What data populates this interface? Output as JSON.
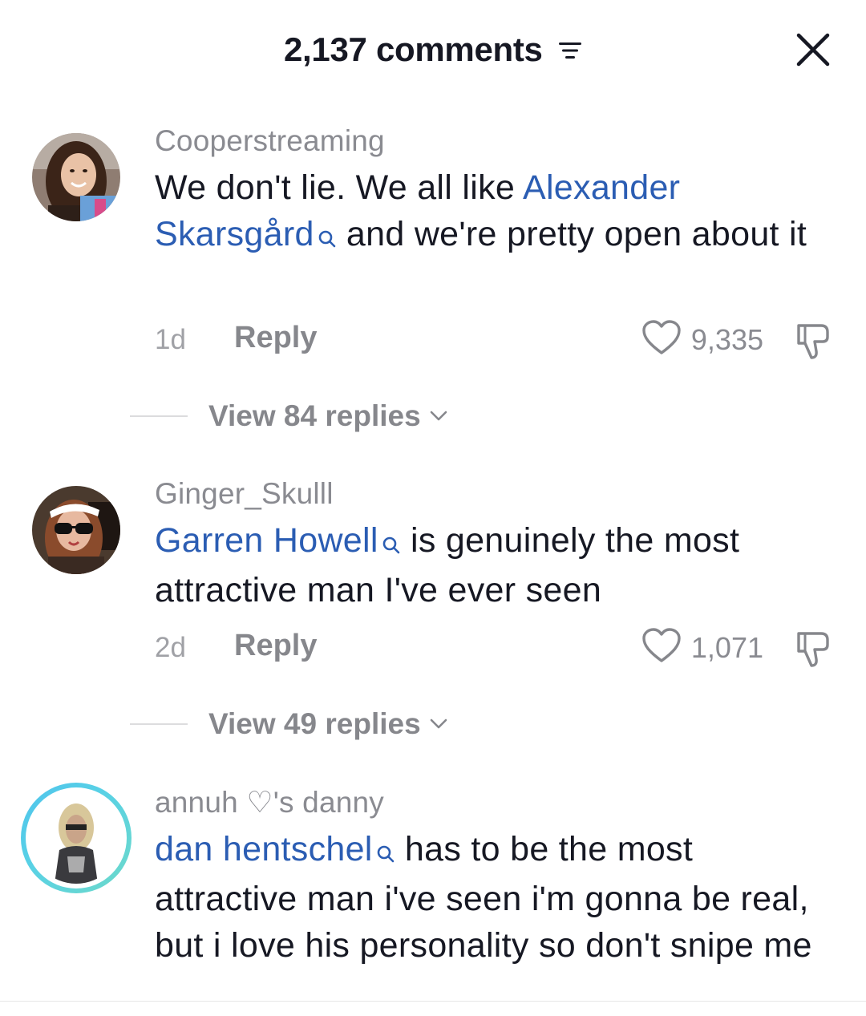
{
  "header": {
    "title": "2,137 comments"
  },
  "comments": [
    {
      "username": "Cooperstreaming",
      "text_before": "We don't lie. We all like ",
      "mention": "Alexander Skarsgård",
      "text_after": " and we're pretty open about it",
      "time": "1d",
      "reply_label": "Reply",
      "likes": "9,335",
      "view_replies": "View 84 replies"
    },
    {
      "username": "Ginger_Skulll",
      "text_before": "",
      "mention": "Garren Howell",
      "text_after": " is genuinely the most attractive man I've ever seen",
      "time": "2d",
      "reply_label": "Reply",
      "likes": "1,071",
      "view_replies": "View 49 replies"
    },
    {
      "username": "annuh ♡'s danny",
      "text_before": "",
      "mention": "dan hentschel",
      "text_after": " has to be the most attractive man i've seen i'm gonna be real, but i love his personality so don't snipe me"
    }
  ],
  "colors": {
    "mention": "#2b5db3",
    "muted": "#8a8b91",
    "text": "#161823",
    "story_ring": "#4fc3ec"
  }
}
